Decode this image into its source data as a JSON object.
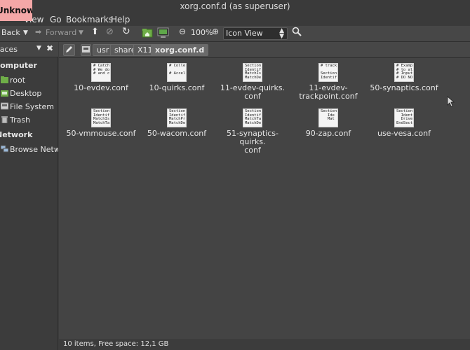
{
  "window": {
    "title": "xorg.conf.d (as superuser)"
  },
  "overlay": {
    "badge": "Unknown",
    "badge_color": "#f4a7a7"
  },
  "menubar": {
    "items": [
      "View",
      "Go",
      "Bookmarks",
      "Help"
    ]
  },
  "toolbar": {
    "back": "Back",
    "forward": "Forward",
    "zoom": "100%",
    "view_mode": "Icon View"
  },
  "sidebar": {
    "header": "Places",
    "sections": [
      {
        "title": "Computer",
        "items": [
          "root",
          "Desktop",
          "File System",
          "Trash"
        ]
      },
      {
        "title": "Network",
        "items": [
          "Browse Network"
        ]
      }
    ]
  },
  "location": {
    "crumbs": [
      "usr",
      "share",
      "X11",
      "xorg.conf.d"
    ]
  },
  "files": [
    {
      "name": "10-evdev.conf",
      "preview": "# Catch\n# We do\n# and c"
    },
    {
      "name": "10-quirks.conf",
      "preview": "# Colle\n\n# Accel"
    },
    {
      "name": "11-evdev-quirks.\nconf",
      "preview": "Section\nIdentif\nMatchIs\nMatchDe"
    },
    {
      "name": "11-evdev-\ntrackpoint.conf",
      "preview": "# track\n\nSection\nIdentif"
    },
    {
      "name": "50-synaptics.conf",
      "preview": "# Examp\n# to al\n# Input\n# DO NO"
    },
    {
      "name": "50-vmmouse.conf",
      "preview": "Section\nIdentif\nMatchIs\nMatchTa"
    },
    {
      "name": "50-wacom.conf",
      "preview": "Section\nIdentif\nMatchPr\nMatchDe"
    },
    {
      "name": "51-synaptics-quirks.\nconf",
      "preview": "Section\nIdentif\nMatchTa\nMatchDe"
    },
    {
      "name": "90-zap.conf",
      "preview": "Section\n   Ide\n   Mat\n"
    },
    {
      "name": "use-vesa.conf",
      "preview": "Section\n  Ident\n  Drive\nEndSect"
    }
  ],
  "status": {
    "text": "10 items, Free space: 12,1 GB"
  }
}
